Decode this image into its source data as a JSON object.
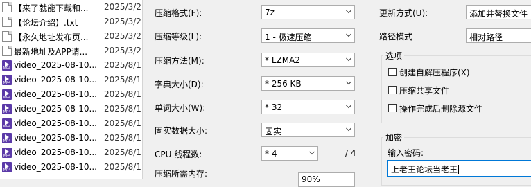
{
  "file_list": [
    {
      "name": "【来了就能下载和...",
      "date": "2025/3/2",
      "icon": "text-file-icon"
    },
    {
      "name": "【论坛介绍】.txt",
      "date": "2025/3/2",
      "icon": "text-file-icon"
    },
    {
      "name": "【永久地址发布页...",
      "date": "2025/3/2",
      "icon": "text-file-icon"
    },
    {
      "name": "最新地址及APP请...",
      "date": "2025/3/2",
      "icon": "text-file-icon"
    },
    {
      "name": "video_2025-08-10...",
      "date": "2025/8/1",
      "icon": "video-file-icon"
    },
    {
      "name": "video_2025-08-10...",
      "date": "2025/8/1",
      "icon": "video-file-icon"
    },
    {
      "name": "video_2025-08-10...",
      "date": "2025/8/1",
      "icon": "video-file-icon"
    },
    {
      "name": "video_2025-08-10...",
      "date": "2025/8/1",
      "icon": "video-file-icon"
    },
    {
      "name": "video_2025-08-10...",
      "date": "2025/8/1",
      "icon": "video-file-icon"
    },
    {
      "name": "video_2025-08-10...",
      "date": "2025/8/1",
      "icon": "video-file-icon"
    },
    {
      "name": "video_2025-08-10...",
      "date": "2025/8/1",
      "icon": "video-file-icon"
    },
    {
      "name": "video_2025-08-10...",
      "date": "2025/8/1",
      "icon": "video-file-icon"
    }
  ],
  "video_icon_text": "MP4",
  "options": {
    "format_label": "压缩格式(F):",
    "format_value": "7z",
    "level_label": "压缩等级(L):",
    "level_value": "1 - 极速压缩",
    "method_label": "压缩方法(M):",
    "method_value": "* LZMA2",
    "dict_label": "字典大小(D):",
    "dict_value": "* 256 KB",
    "word_label": "单词大小(W):",
    "word_value": "* 32",
    "solid_label": "固实数据大小:",
    "solid_value": "固实",
    "threads_label": "CPU 线程数:",
    "threads_value": "* 4",
    "threads_max": "/ 4",
    "memory_label": "压缩所需内存:",
    "memory_value": "90%"
  },
  "right": {
    "update_label": "更新方式(U):",
    "update_value": "添加并替换文件",
    "path_label": "路径模式",
    "path_value": "相对路径",
    "options_group": "选项",
    "sfx_label": "创建自解压程序(X)",
    "shared_label": "压缩共享文件",
    "delete_label": "操作完成后删除源文件",
    "encrypt_group": "加密",
    "password_label": "输入密码:",
    "password_value": "上老王论坛当老王"
  }
}
